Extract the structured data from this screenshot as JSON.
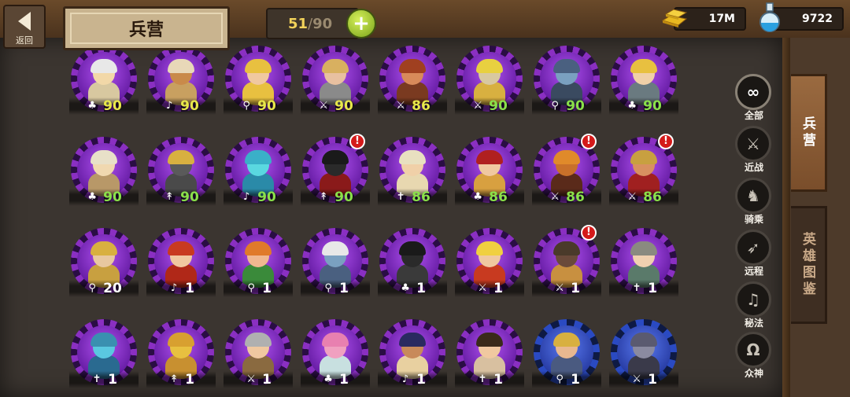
{
  "header": {
    "back_label": "返回",
    "title": "兵营",
    "capacity": {
      "current": "51",
      "separator": "/",
      "max": "90"
    },
    "add_label": "+",
    "gold": "17M",
    "potion": "9722"
  },
  "units": [
    {
      "type_icon": "cavalry",
      "level": "90",
      "level_color": "y",
      "frame": "purple",
      "alert": false,
      "palette": {
        "head": "#f2d8a8",
        "helm": "#e8e8e8",
        "body": "#d8c8a0"
      }
    },
    {
      "type_icon": "mystic",
      "level": "90",
      "level_color": "y",
      "frame": "purple",
      "alert": false,
      "palette": {
        "head": "#c98a4a",
        "helm": "#e8d8b8",
        "body": "#c8a060"
      }
    },
    {
      "type_icon": "ranged",
      "level": "90",
      "level_color": "y",
      "frame": "purple",
      "alert": false,
      "palette": {
        "head": "#f0c8a0",
        "helm": "#e8c040",
        "body": "#e8c040"
      }
    },
    {
      "type_icon": "melee",
      "level": "90",
      "level_color": "y",
      "frame": "purple",
      "alert": false,
      "palette": {
        "head": "#e8c0a0",
        "helm": "#d8b060",
        "body": "#8a8a8a"
      }
    },
    {
      "type_icon": "melee",
      "level": "86",
      "level_color": "y",
      "frame": "purple",
      "alert": false,
      "palette": {
        "head": "#d88a5a",
        "helm": "#a04020",
        "body": "#7a3a20"
      }
    },
    {
      "type_icon": "melee",
      "level": "90",
      "level_color": "g",
      "frame": "purple",
      "alert": false,
      "palette": {
        "head": "#d8c8a0",
        "helm": "#e8d040",
        "body": "#d8b040"
      }
    },
    {
      "type_icon": "ranged",
      "level": "90",
      "level_color": "g",
      "frame": "purple",
      "alert": false,
      "palette": {
        "head": "#7aa0c0",
        "helm": "#4a6080",
        "body": "#3a4a60"
      }
    },
    {
      "type_icon": "cavalry",
      "level": "90",
      "level_color": "g",
      "frame": "purple",
      "alert": false,
      "palette": {
        "head": "#f0d0a8",
        "helm": "#e8c040",
        "body": "#6a7a80"
      }
    },
    {
      "type_icon": "cavalry",
      "level": "90",
      "level_color": "g",
      "frame": "purple",
      "alert": false,
      "palette": {
        "head": "#f0d8b0",
        "helm": "#e8e0c8",
        "body": "#b89868"
      }
    },
    {
      "type_icon": "support",
      "level": "90",
      "level_color": "g",
      "frame": "purple",
      "alert": false,
      "palette": {
        "head": "#5a5a5a",
        "helm": "#d8b040",
        "body": "#4a4a4a"
      }
    },
    {
      "type_icon": "mystic",
      "level": "90",
      "level_color": "g",
      "frame": "purple",
      "alert": false,
      "palette": {
        "head": "#5ad8e0",
        "helm": "#3ab0c8",
        "body": "#2a8aa8"
      }
    },
    {
      "type_icon": "support",
      "level": "90",
      "level_color": "g",
      "frame": "purple",
      "alert": true,
      "palette": {
        "head": "#2a2a2a",
        "helm": "#1a1a1a",
        "body": "#8a1a1a"
      }
    },
    {
      "type_icon": "holy",
      "level": "86",
      "level_color": "g",
      "frame": "purple",
      "alert": false,
      "palette": {
        "head": "#f0d0a8",
        "helm": "#e8e0c0",
        "body": "#e8d8b0"
      }
    },
    {
      "type_icon": "cavalry",
      "level": "86",
      "level_color": "g",
      "frame": "purple",
      "alert": false,
      "palette": {
        "head": "#f0c8a0",
        "helm": "#b02020",
        "body": "#d8a040"
      }
    },
    {
      "type_icon": "melee",
      "level": "86",
      "level_color": "g",
      "frame": "purple",
      "alert": true,
      "palette": {
        "head": "#c8702a",
        "helm": "#e08a2a",
        "body": "#5a2a1a"
      }
    },
    {
      "type_icon": "melee",
      "level": "86",
      "level_color": "g",
      "frame": "purple",
      "alert": true,
      "palette": {
        "head": "#d89060",
        "helm": "#c8a040",
        "body": "#a02020"
      }
    },
    {
      "type_icon": "ranged",
      "level": "20",
      "level_color": "w",
      "frame": "purple",
      "alert": false,
      "palette": {
        "head": "#e8c8a0",
        "helm": "#d8b040",
        "body": "#c8a040"
      }
    },
    {
      "type_icon": "mystic",
      "level": "1",
      "level_color": "w",
      "frame": "purple",
      "alert": false,
      "palette": {
        "head": "#f0c8a0",
        "helm": "#c83a20",
        "body": "#b02818"
      }
    },
    {
      "type_icon": "ranged",
      "level": "1",
      "level_color": "w",
      "frame": "purple",
      "alert": false,
      "palette": {
        "head": "#f0b890",
        "helm": "#e07a2a",
        "body": "#3a8a3a"
      }
    },
    {
      "type_icon": "ranged",
      "level": "1",
      "level_color": "w",
      "frame": "purple",
      "alert": false,
      "palette": {
        "head": "#7aa0c0",
        "helm": "#e8e8e8",
        "body": "#4a6080"
      }
    },
    {
      "type_icon": "cavalry",
      "level": "1",
      "level_color": "w",
      "frame": "purple",
      "alert": false,
      "palette": {
        "head": "#2a2a2a",
        "helm": "#1a1a1a",
        "body": "#3a3a3a"
      }
    },
    {
      "type_icon": "melee",
      "level": "1",
      "level_color": "w",
      "frame": "purple",
      "alert": false,
      "palette": {
        "head": "#f0c8a0",
        "helm": "#f0d040",
        "body": "#c83a20"
      }
    },
    {
      "type_icon": "melee",
      "level": "1",
      "level_color": "w",
      "frame": "purple",
      "alert": true,
      "palette": {
        "head": "#6a4a3a",
        "helm": "#4a3a2a",
        "body": "#c89040"
      }
    },
    {
      "type_icon": "holy",
      "level": "1",
      "level_color": "w",
      "frame": "purple",
      "alert": false,
      "palette": {
        "head": "#f0d0b0",
        "helm": "#8a8a80",
        "body": "#5a7a6a"
      }
    },
    {
      "type_icon": "holy",
      "level": "1",
      "level_color": "w",
      "frame": "purple",
      "alert": false,
      "palette": {
        "head": "#5ac8e0",
        "helm": "#3a90b0",
        "body": "#2a6a90"
      }
    },
    {
      "type_icon": "support",
      "level": "1",
      "level_color": "w",
      "frame": "purple",
      "alert": false,
      "palette": {
        "head": "#e8c040",
        "helm": "#d8a030",
        "body": "#c89030"
      }
    },
    {
      "type_icon": "melee",
      "level": "1",
      "level_color": "w",
      "frame": "purple",
      "alert": false,
      "palette": {
        "head": "#f0c8a0",
        "helm": "#b0b0b0",
        "body": "#8a6a40"
      }
    },
    {
      "type_icon": "cavalry",
      "level": "1",
      "level_color": "w",
      "frame": "purple",
      "alert": false,
      "palette": {
        "head": "#f0a0c0",
        "helm": "#e880b0",
        "body": "#c8e0e0"
      }
    },
    {
      "type_icon": "mystic",
      "level": "1",
      "level_color": "w",
      "frame": "purple",
      "alert": false,
      "palette": {
        "head": "#c88a5a",
        "helm": "#2a2a60",
        "body": "#e8d0a0"
      }
    },
    {
      "type_icon": "holy",
      "level": "1",
      "level_color": "w",
      "frame": "purple",
      "alert": false,
      "palette": {
        "head": "#f0c8a0",
        "helm": "#3a2a1a",
        "body": "#d8c0a0"
      }
    },
    {
      "type_icon": "ranged",
      "level": "1",
      "level_color": "w",
      "frame": "blue",
      "alert": false,
      "palette": {
        "head": "#e8b890",
        "helm": "#d8b040",
        "body": "#4a5a80"
      }
    },
    {
      "type_icon": "melee",
      "level": "1",
      "level_color": "w",
      "frame": "blue",
      "alert": false,
      "palette": {
        "head": "#8a8aa0",
        "helm": "#5a5a70",
        "body": "#3a3a4a"
      }
    }
  ],
  "filters": [
    {
      "icon": "infinity-icon",
      "glyph": "∞",
      "label": "全部"
    },
    {
      "icon": "sword-icon",
      "glyph": "⚔",
      "label": "近战"
    },
    {
      "icon": "horse-icon",
      "glyph": "♞",
      "label": "骑乘"
    },
    {
      "icon": "bow-icon",
      "glyph": "➶",
      "label": "远程"
    },
    {
      "icon": "music-note-icon",
      "glyph": "♫",
      "label": "秘法"
    },
    {
      "icon": "omega-icon",
      "glyph": "Ω",
      "label": "众神"
    }
  ],
  "side_tabs": {
    "barracks": "兵营",
    "heroes": "英雄图鉴"
  },
  "type_glyphs": {
    "cavalry": "♣",
    "mystic": "♪",
    "ranged": "⚲",
    "melee": "⚔",
    "support": "↟",
    "holy": "✝"
  }
}
